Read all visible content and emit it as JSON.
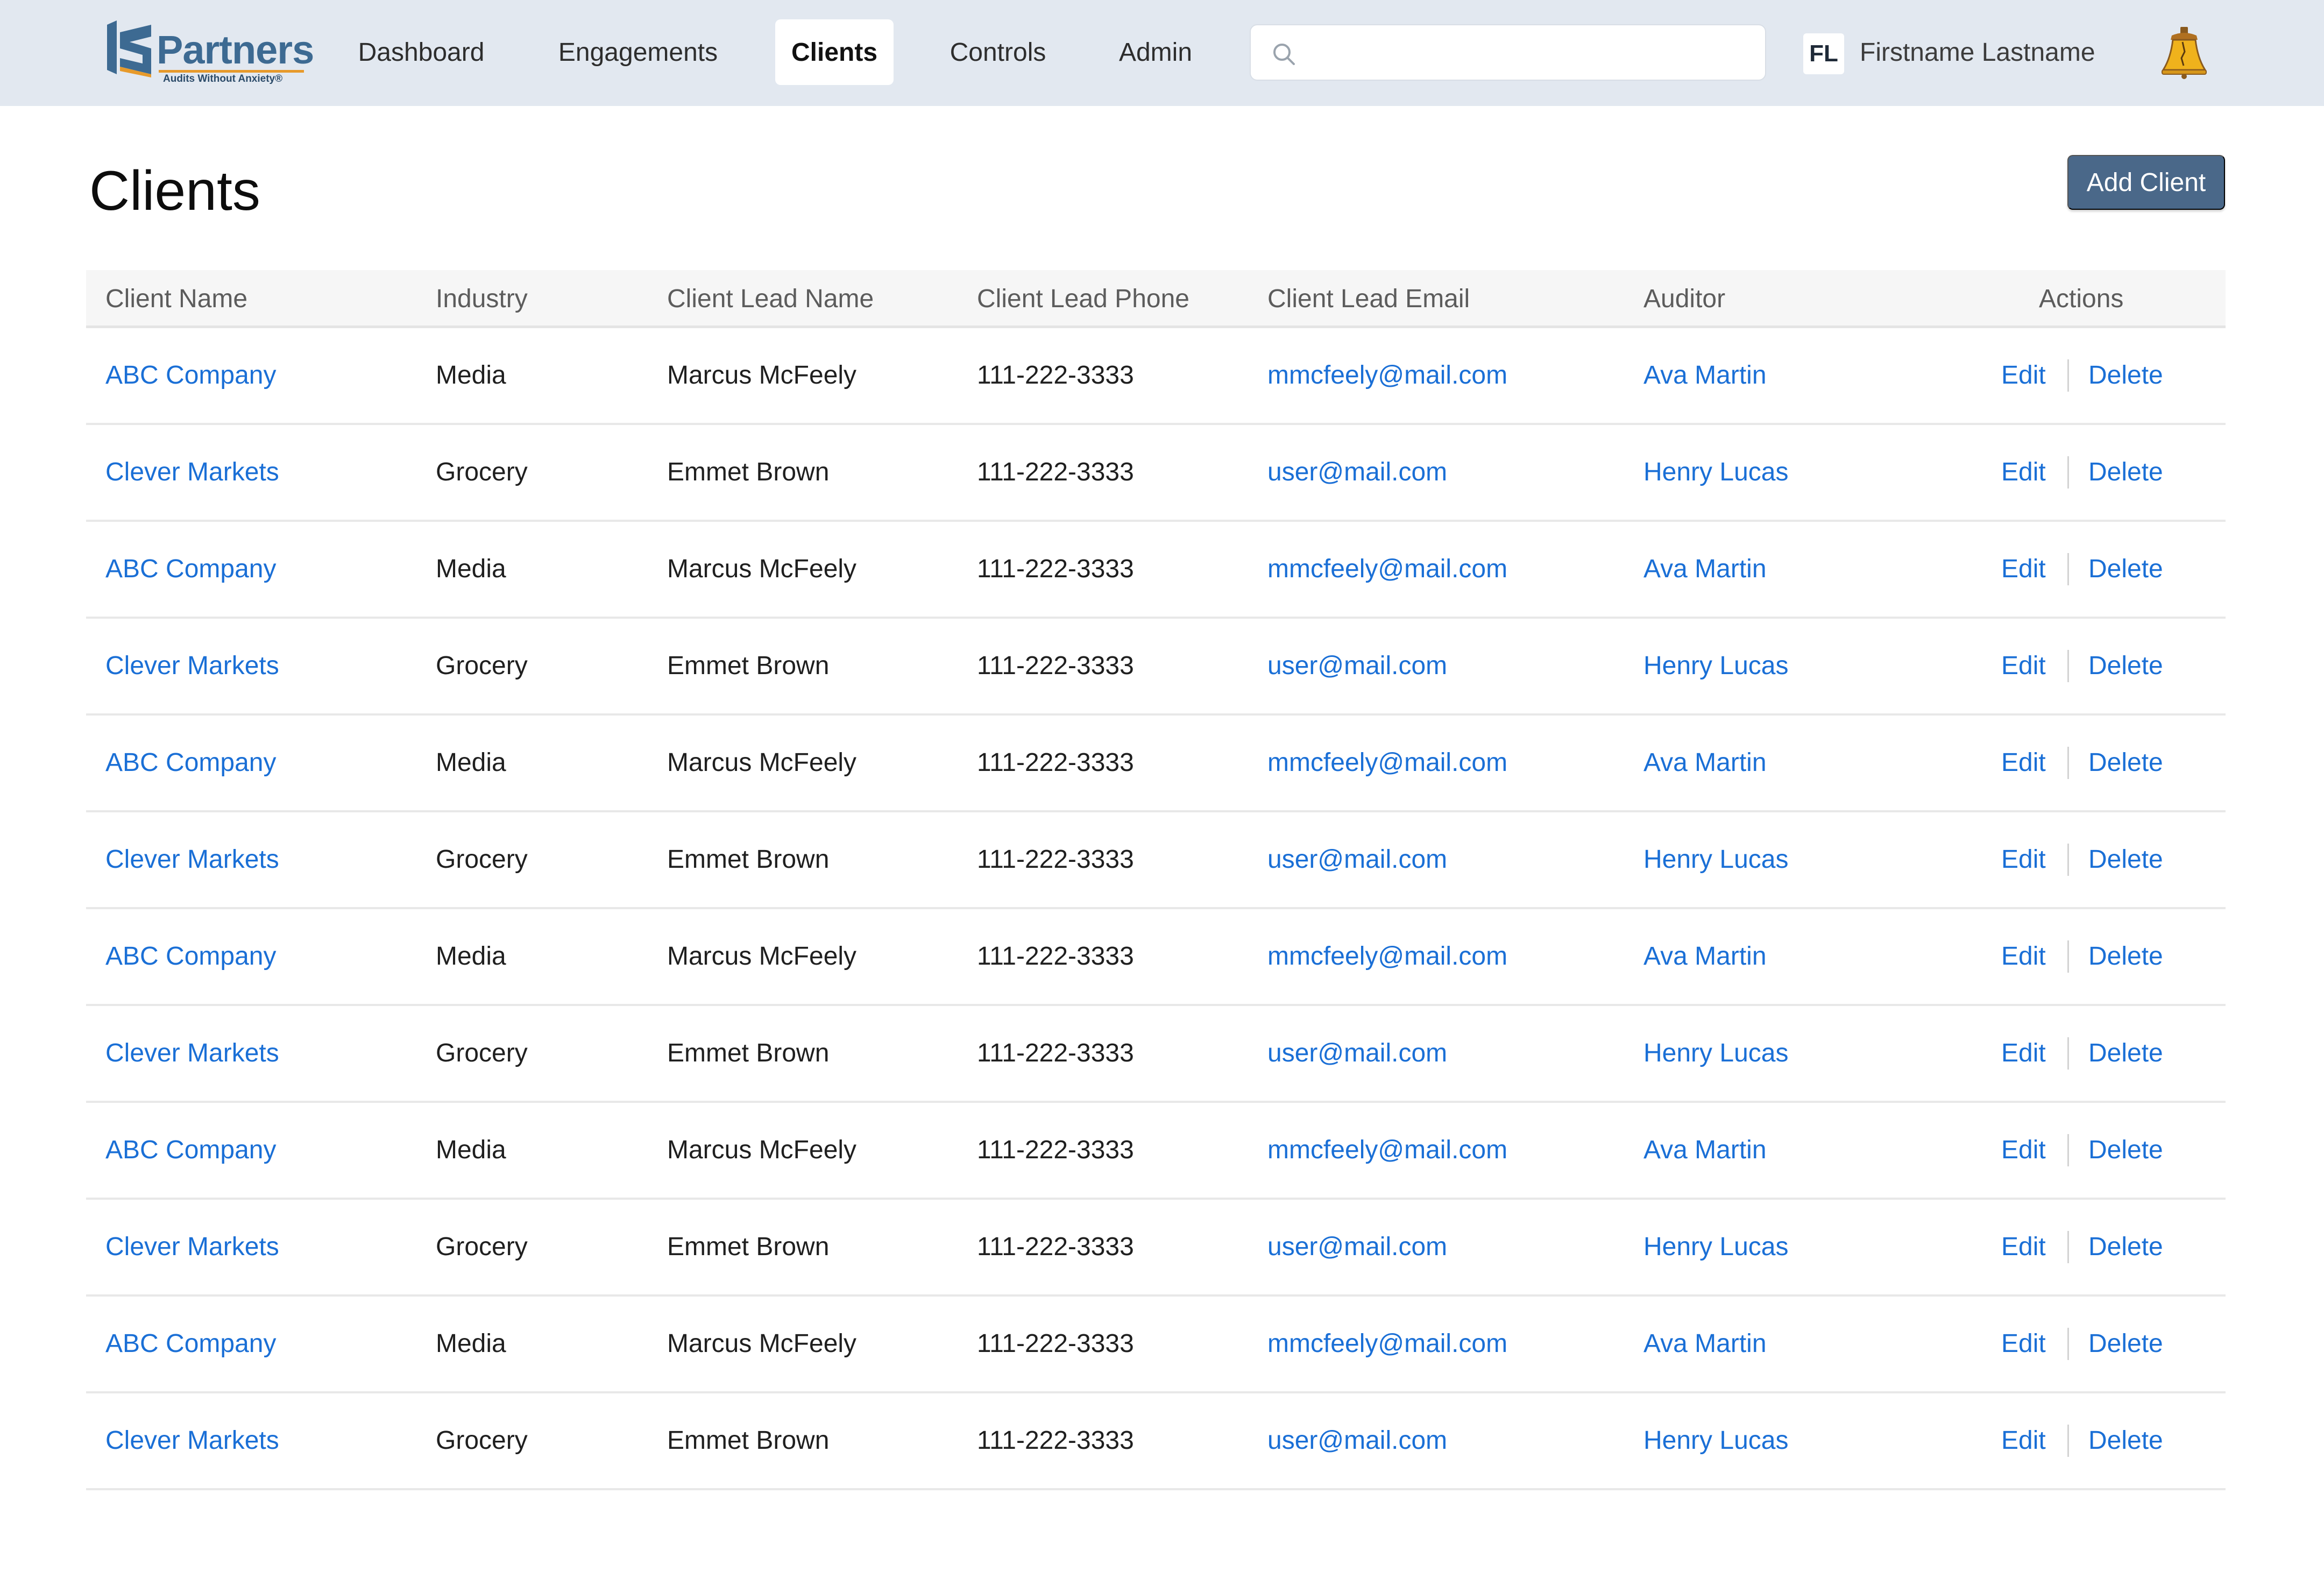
{
  "brand": {
    "name": "Partners",
    "tagline": "Audits Without Anxiety®",
    "accent": "#3d6a92",
    "underline": "#e79a2b"
  },
  "nav": {
    "items": [
      {
        "label": "Dashboard",
        "active": false
      },
      {
        "label": "Engagements",
        "active": false
      },
      {
        "label": "Clients",
        "active": true
      },
      {
        "label": "Controls",
        "active": false
      },
      {
        "label": "Admin",
        "active": false
      }
    ],
    "search": {
      "value": "",
      "placeholder": "",
      "icon": "search-icon"
    },
    "user": {
      "initials": "FL",
      "name": "Firstname Lastname"
    },
    "bell_icon": "liberty-bell-icon"
  },
  "page": {
    "title": "Clients",
    "add_button": "Add Client",
    "button_color": "#4a6889",
    "link_color": "#1a6fd6"
  },
  "table": {
    "columns": [
      "Client Name",
      "Industry",
      "Client Lead Name",
      "Client Lead Phone",
      "Client Lead Email",
      "Auditor",
      "Actions"
    ],
    "action_labels": {
      "edit": "Edit",
      "delete": "Delete"
    },
    "rows": [
      {
        "client": "ABC Company",
        "industry": "Media",
        "lead": "Marcus McFeely",
        "phone": "111-222-3333",
        "email": "mmcfeely@mail.com",
        "auditor": "Ava Martin"
      },
      {
        "client": "Clever Markets",
        "industry": "Grocery",
        "lead": "Emmet Brown",
        "phone": "111-222-3333",
        "email": "user@mail.com",
        "auditor": "Henry Lucas"
      },
      {
        "client": "ABC Company",
        "industry": "Media",
        "lead": "Marcus McFeely",
        "phone": "111-222-3333",
        "email": "mmcfeely@mail.com",
        "auditor": "Ava Martin"
      },
      {
        "client": "Clever Markets",
        "industry": "Grocery",
        "lead": "Emmet Brown",
        "phone": "111-222-3333",
        "email": "user@mail.com",
        "auditor": "Henry Lucas"
      },
      {
        "client": "ABC Company",
        "industry": "Media",
        "lead": "Marcus McFeely",
        "phone": "111-222-3333",
        "email": "mmcfeely@mail.com",
        "auditor": "Ava Martin"
      },
      {
        "client": "Clever Markets",
        "industry": "Grocery",
        "lead": "Emmet Brown",
        "phone": "111-222-3333",
        "email": "user@mail.com",
        "auditor": "Henry Lucas"
      },
      {
        "client": "ABC Company",
        "industry": "Media",
        "lead": "Marcus McFeely",
        "phone": "111-222-3333",
        "email": "mmcfeely@mail.com",
        "auditor": "Ava Martin"
      },
      {
        "client": "Clever Markets",
        "industry": "Grocery",
        "lead": "Emmet Brown",
        "phone": "111-222-3333",
        "email": "user@mail.com",
        "auditor": "Henry Lucas"
      },
      {
        "client": "ABC Company",
        "industry": "Media",
        "lead": "Marcus McFeely",
        "phone": "111-222-3333",
        "email": "mmcfeely@mail.com",
        "auditor": "Ava Martin"
      },
      {
        "client": "Clever Markets",
        "industry": "Grocery",
        "lead": "Emmet Brown",
        "phone": "111-222-3333",
        "email": "user@mail.com",
        "auditor": "Henry Lucas"
      },
      {
        "client": "ABC Company",
        "industry": "Media",
        "lead": "Marcus McFeely",
        "phone": "111-222-3333",
        "email": "mmcfeely@mail.com",
        "auditor": "Ava Martin"
      },
      {
        "client": "Clever Markets",
        "industry": "Grocery",
        "lead": "Emmet Brown",
        "phone": "111-222-3333",
        "email": "user@mail.com",
        "auditor": "Henry Lucas"
      }
    ]
  }
}
